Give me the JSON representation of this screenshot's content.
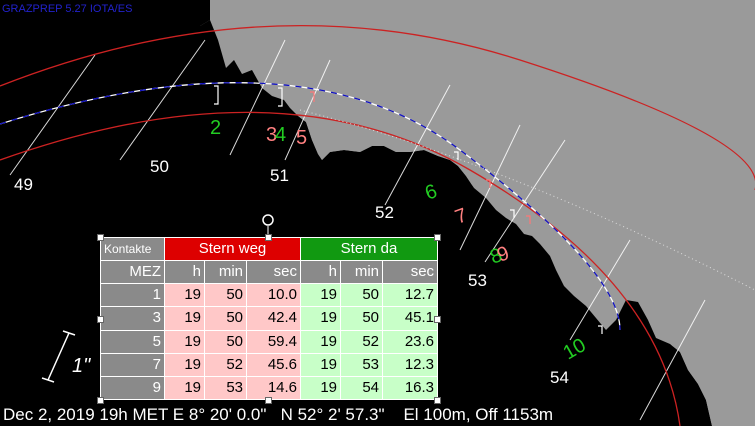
{
  "app": {
    "title": "GRAZPREP 5.27 IOTA/ES"
  },
  "graph_labels": {
    "band": [
      "49",
      "50",
      "51",
      "52",
      "53",
      "54"
    ],
    "events": [
      "2",
      "3",
      "4",
      "5",
      "6",
      "7",
      "8",
      "9",
      "10"
    ],
    "scale": "1\""
  },
  "colors": {
    "sky": "#9a9a9a",
    "limb": "#000000",
    "limit_lines": "#cc2222",
    "centerline": "#1010c0",
    "grid_lines": "#ffffff",
    "event_green": "#22cc22",
    "event_pink": "#ff8080",
    "table_red": "#dd0000",
    "table_green": "#119911"
  },
  "table": {
    "corner": "Kontakte",
    "group_disappear": "Stern weg",
    "group_reappear": "Stern da",
    "row_header": "MEZ",
    "col_h": "h",
    "col_min": "min",
    "col_sec": "sec",
    "rows": [
      {
        "idx": "1",
        "weg": {
          "h": "19",
          "min": "50",
          "sec": "10.0"
        },
        "da": {
          "h": "19",
          "min": "50",
          "sec": "12.7"
        }
      },
      {
        "idx": "3",
        "weg": {
          "h": "19",
          "min": "50",
          "sec": "42.4"
        },
        "da": {
          "h": "19",
          "min": "50",
          "sec": "45.1"
        }
      },
      {
        "idx": "5",
        "weg": {
          "h": "19",
          "min": "50",
          "sec": "59.4"
        },
        "da": {
          "h": "19",
          "min": "52",
          "sec": "23.6"
        }
      },
      {
        "idx": "7",
        "weg": {
          "h": "19",
          "min": "52",
          "sec": "45.6"
        },
        "da": {
          "h": "19",
          "min": "53",
          "sec": "12.3"
        }
      },
      {
        "idx": "9",
        "weg": {
          "h": "19",
          "min": "53",
          "sec": "14.6"
        },
        "da": {
          "h": "19",
          "min": "54",
          "sec": "16.3"
        }
      }
    ]
  },
  "status": {
    "date": "Dec 2, 2019 19h MET",
    "lon": "E 8° 20' 0.0\"",
    "lat": "N 52° 2' 57.3\"",
    "elev": "El 100m, Off 1153m"
  }
}
